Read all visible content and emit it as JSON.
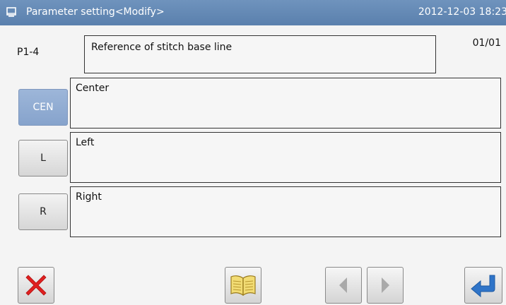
{
  "titlebar": {
    "icon": "monitor-icon",
    "title": "Parameter setting<Modify>",
    "datetime": "2012-12-03 18:23"
  },
  "parameter": {
    "id": "P1-4",
    "name": "Reference of stitch base line",
    "page": "01/01"
  },
  "options": [
    {
      "button_label": "CEN",
      "description": "Center",
      "selected": true
    },
    {
      "button_label": "L",
      "description": "Left",
      "selected": false
    },
    {
      "button_label": "R",
      "description": "Right",
      "selected": false
    }
  ],
  "toolbar": {
    "cancel_icon": "close-x-icon",
    "manual_icon": "book-icon",
    "prev_icon": "triangle-left-icon",
    "next_icon": "triangle-right-icon",
    "enter_icon": "enter-arrow-icon"
  },
  "colors": {
    "titlebar": "#5f86b4",
    "selected_button": "#8faad1",
    "cancel_red": "#e02020",
    "enter_blue": "#2f74c8",
    "book_yellow": "#e8cd58"
  }
}
